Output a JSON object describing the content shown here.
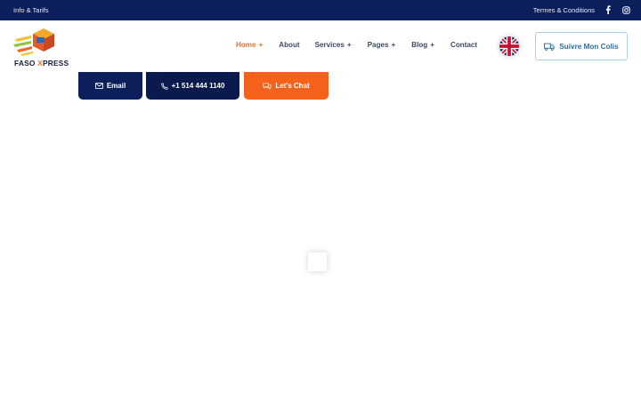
{
  "topbar": {
    "left_link": "Info & Tarifs",
    "terms_link": "Termes & Conditions",
    "social": [
      {
        "icon": "facebook-icon"
      },
      {
        "icon": "instagram-icon"
      }
    ]
  },
  "header": {
    "logo": {
      "brand_main": "FASO ",
      "brand_x": "X",
      "brand_rest": "PRESS"
    },
    "nav": [
      {
        "label": "Home",
        "has_submenu": true,
        "active": true
      },
      {
        "label": "About",
        "has_submenu": false,
        "active": false
      },
      {
        "label": "Services",
        "has_submenu": true,
        "active": false
      },
      {
        "label": "Pages",
        "has_submenu": true,
        "active": false
      },
      {
        "label": "Blog",
        "has_submenu": true,
        "active": false
      },
      {
        "label": "Contact",
        "has_submenu": false,
        "active": false
      }
    ],
    "language_flag": "uk-flag-icon",
    "track_button": "Suivre Mon Colis"
  },
  "cta": {
    "email": "Email",
    "phone": "+1 514 444 1140",
    "chat": "Let's Chat"
  },
  "colors": {
    "navy": "#0c1f5a",
    "orange": "#f5621c",
    "active_nav": "#e8742b",
    "track_text": "#2b6fa0"
  }
}
